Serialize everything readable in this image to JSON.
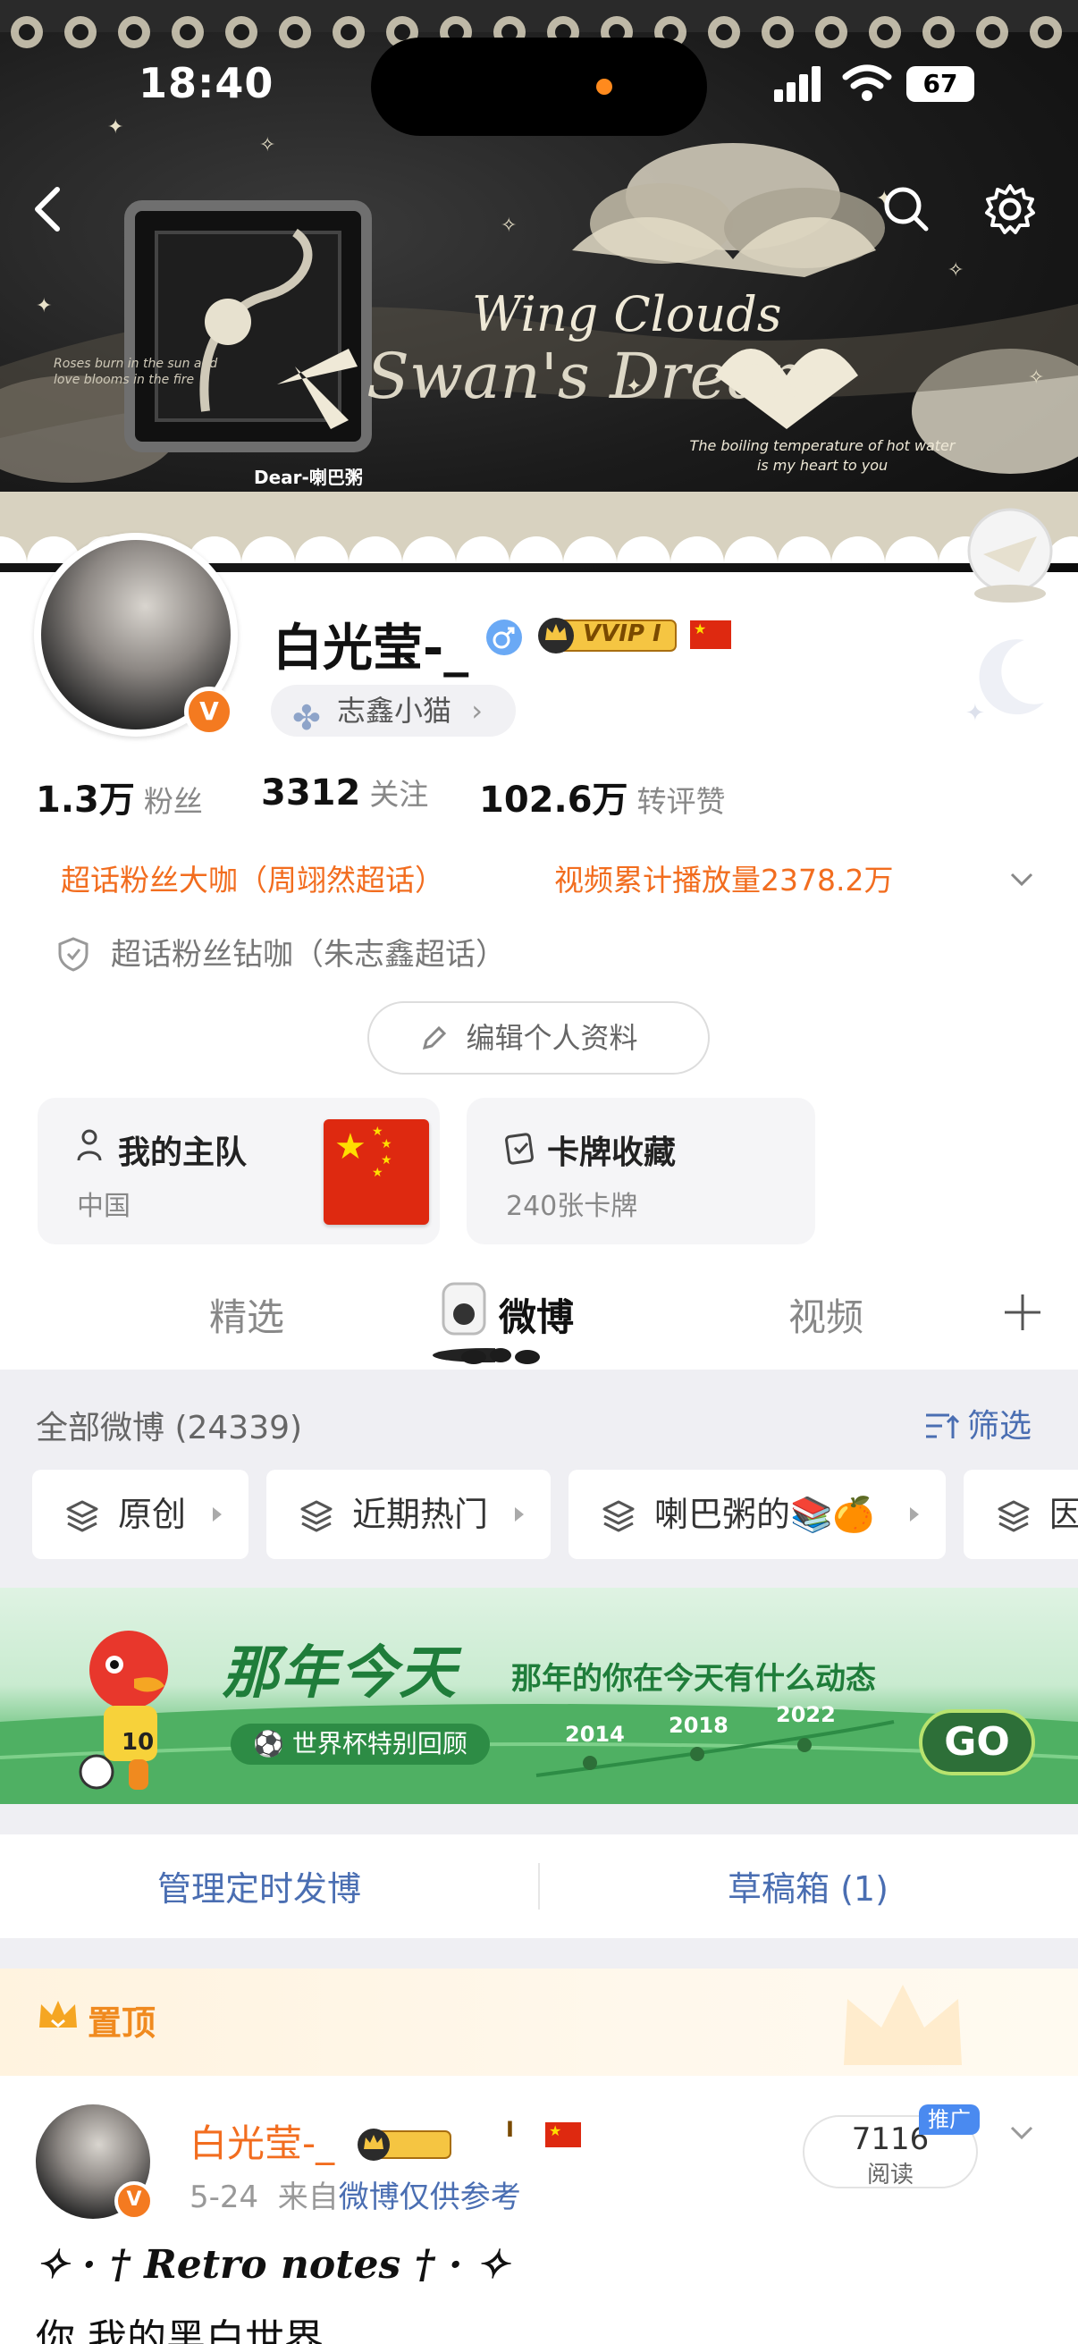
{
  "status": {
    "time": "18:40",
    "battery": "67"
  },
  "banner": {
    "title_line1": "Wing Clouds",
    "title_line2": "Swan's Dream",
    "watermark": "Dear-喇巴粥",
    "tagline": "The boiling temperature of hot water is my heart to you",
    "left_text": "Roses burn in the sun and love blooms in the fire"
  },
  "profile": {
    "name": "白光莹-_",
    "vip_badge": "VVIP I",
    "tag": "志鑫小猫",
    "stats": [
      {
        "value": "1.3万",
        "label": "粉丝"
      },
      {
        "value": "3312",
        "label": "关注"
      },
      {
        "value": "102.6万",
        "label": "转评赞"
      }
    ],
    "honor1": "超话粉丝大咖（周翊然超话）",
    "honor2": "视频累计播放量2378.2万",
    "honor3": "超话粉丝钻咖（朱志鑫超话）",
    "edit_button": "编辑个人资料",
    "card_team_title": "我的主队",
    "card_team_sub": "中国",
    "card_collect_title": "卡牌收藏",
    "card_collect_sub": "240张卡牌"
  },
  "tabs": [
    "精选",
    "微博",
    "视频"
  ],
  "feed": {
    "all_count": "全部微博 (24339)",
    "filter": "筛选",
    "chips": [
      "原创",
      "近期热门",
      "喇巴粥的📚🍊",
      "因"
    ]
  },
  "anniversary": {
    "title": "那年今天",
    "subtitle": "那年的你在今天有什么动态",
    "pill": "世界杯特别回顾",
    "years": [
      "2014",
      "2018",
      "2022"
    ],
    "go": "GO",
    "jersey": "10"
  },
  "manage": {
    "scheduled": "管理定时发博",
    "drafts": "草稿箱 (1)"
  },
  "pinned": {
    "label": "置顶"
  },
  "post": {
    "name": "白光莹-_",
    "badge": "I",
    "date": "5-24",
    "source_prefix": "来自",
    "source": "微博仅供参考",
    "reads": "7116",
    "reads_label": "阅读",
    "promo": "推广",
    "text_line1": "✧ · † 𝑹𝒆𝒕𝒓𝒐 𝒏𝒐𝒕𝒆𝒔 † · ✧",
    "text_line2": "你 我的黑白世界"
  },
  "colors": {
    "accent_orange": "#f26d1f",
    "link_blue": "#4a6eb2",
    "vip_gold": "#f5c542"
  }
}
